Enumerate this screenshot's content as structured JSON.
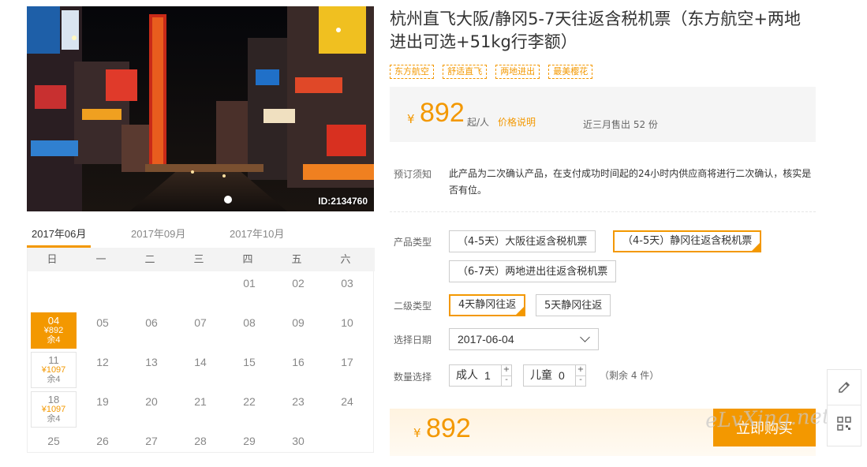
{
  "gallery": {
    "image_id": "ID:2134760"
  },
  "calendar": {
    "tabs": [
      "2017年06月",
      "2017年09月",
      "2017年10月"
    ],
    "weekdays": [
      "日",
      "一",
      "二",
      "三",
      "四",
      "五",
      "六"
    ],
    "days": [
      {
        "num": "01"
      },
      {
        "num": "02"
      },
      {
        "num": "03"
      },
      {
        "num": "04",
        "price": "¥892",
        "remain": "余4",
        "selected": true
      },
      {
        "num": "05"
      },
      {
        "num": "06"
      },
      {
        "num": "07"
      },
      {
        "num": "08"
      },
      {
        "num": "09"
      },
      {
        "num": "10"
      },
      {
        "num": "11",
        "price": "¥1097",
        "remain": "余4"
      },
      {
        "num": "12"
      },
      {
        "num": "13"
      },
      {
        "num": "14"
      },
      {
        "num": "15"
      },
      {
        "num": "16"
      },
      {
        "num": "17"
      },
      {
        "num": "18",
        "price": "¥1097",
        "remain": "余4"
      },
      {
        "num": "19"
      },
      {
        "num": "20"
      },
      {
        "num": "21"
      },
      {
        "num": "22"
      },
      {
        "num": "23"
      },
      {
        "num": "24"
      },
      {
        "num": "25"
      },
      {
        "num": "26"
      },
      {
        "num": "27"
      },
      {
        "num": "28"
      },
      {
        "num": "29"
      },
      {
        "num": "30"
      }
    ]
  },
  "product": {
    "title": "杭州直飞大阪/静冈5-7天往返含税机票（东方航空+两地进出可选+51kg行李额）",
    "tags": [
      "东方航空",
      "舒适直飞",
      "两地进出",
      "最美樱花"
    ]
  },
  "pricebox": {
    "currency": "¥",
    "price": "892",
    "unit": "起/人",
    "price_note": "价格说明",
    "sold": "近三月售出 52 份"
  },
  "booking": {
    "notes_label": "预订须知",
    "notes": "此产品为二次确认产品，在支付成功时间起的24小时内供应商将进行二次确认，核实是否有位。",
    "type_label": "产品类型",
    "types": [
      "（4-5天）大阪往返含税机票",
      "（4-5天）静冈往返含税机票",
      "（6-7天）两地进出往返含税机票"
    ],
    "subtype_label": "二级类型",
    "subtypes": [
      "4天静冈往返",
      "5天静冈往返"
    ],
    "date_label": "选择日期",
    "date_value": "2017-06-04",
    "qty_label": "数量选择",
    "adult_label": "成人",
    "adult_value": "1",
    "child_label": "儿童",
    "child_value": "0",
    "remain": "（剩余 4 件）"
  },
  "bottom": {
    "currency": "¥",
    "price": "892",
    "buy_label": "立即购买"
  },
  "watermark": "eLvXing.net",
  "colors": {
    "accent": "#f39800"
  }
}
